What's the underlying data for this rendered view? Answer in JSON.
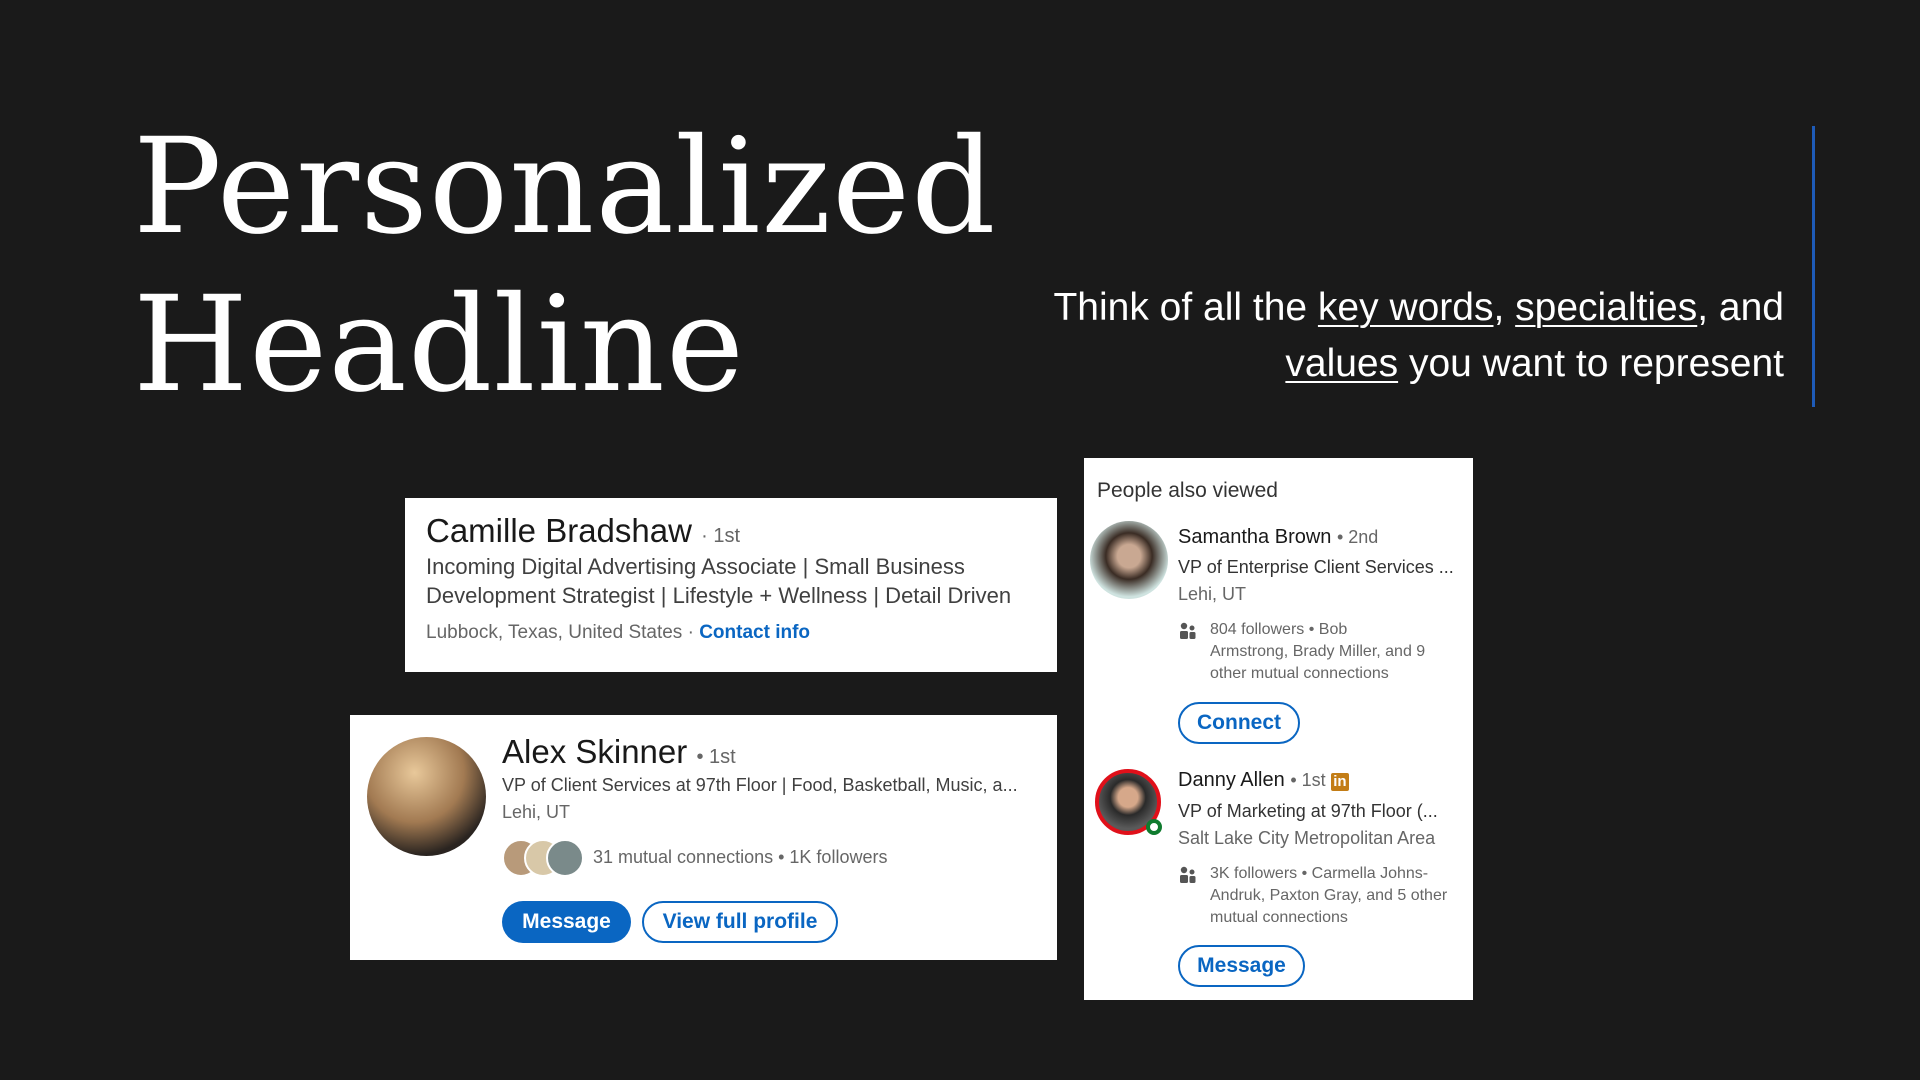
{
  "slide": {
    "title_line1": "Personalized",
    "title_line2": "Headline",
    "subtitle": {
      "pre": "Think of all the ",
      "kw1": "key words",
      "sep1": ", ",
      "kw2": "specialties",
      "sep2": ", and",
      "kw3": "values",
      "post": " you want to represent"
    },
    "accent_color": "#1e5bb8"
  },
  "card_camille": {
    "name": "Camille Bradshaw",
    "degree": "· 1st",
    "headline_line1": "Incoming Digital Advertising Associate | Small Business",
    "headline_line2": "Development Strategist | Lifestyle + Wellness | Detail Driven",
    "location": "Lubbock, Texas, United States ·",
    "contact_link": "Contact info"
  },
  "card_alex": {
    "name": "Alex Skinner",
    "degree": "• 1st",
    "headline": "VP of Client Services at 97th Floor | Food, Basketball, Music, a...",
    "location": "Lehi, UT",
    "mutual": "31 mutual connections • 1K followers",
    "message_button": "Message",
    "view_profile_button": "View full profile"
  },
  "people_also_viewed": {
    "header": "People also viewed",
    "people": [
      {
        "name": "Samantha Brown",
        "degree": "• 2nd",
        "headline": "VP of Enterprise Client Services ...",
        "location": "Lehi, UT",
        "connections_line1": "804 followers • Bob",
        "connections_line2": "Armstrong, Brady Miller, and 9",
        "connections_line3": "other mutual connections",
        "button": "Connect"
      },
      {
        "name": "Danny Allen",
        "degree": "• 1st",
        "badge": "in",
        "headline": "VP of Marketing at 97th Floor (...",
        "location": "Salt Lake City Metropolitan Area",
        "connections_line1": "3K followers • Carmella Johns-",
        "connections_line2": "Andruk, Paxton Gray, and 5 other",
        "connections_line3": "mutual connections",
        "button": "Message"
      }
    ]
  }
}
